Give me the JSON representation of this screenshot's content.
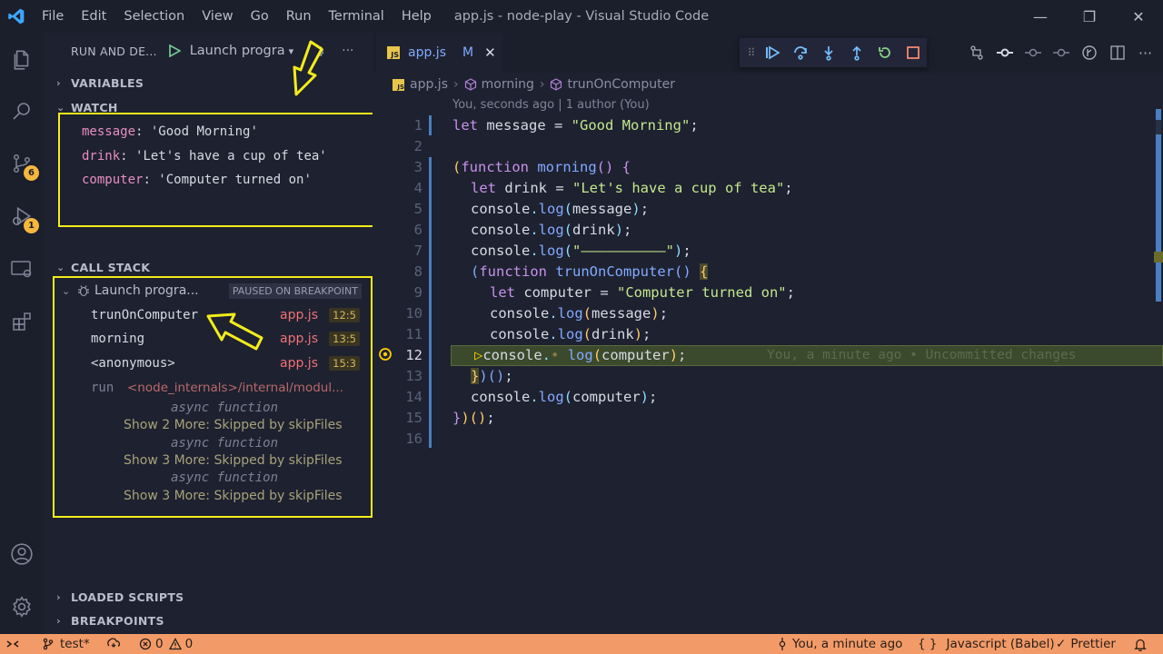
{
  "titlebar": {
    "menu": [
      "File",
      "Edit",
      "Selection",
      "View",
      "Go",
      "Run",
      "Terminal",
      "Help"
    ],
    "title": "app.js - node-play - Visual Studio Code"
  },
  "activity": {
    "source_control_badge": "6",
    "debug_badge": "1"
  },
  "sidebar": {
    "header_title": "RUN AND DE...",
    "launch_config": "Launch progra",
    "sections": {
      "variables": "VARIABLES",
      "watch": "WATCH",
      "call_stack": "CALL STACK",
      "loaded_scripts": "LOADED SCRIPTS",
      "breakpoints": "BREAKPOINTS"
    },
    "watch": [
      {
        "name": "message",
        "value": "'Good Morning'"
      },
      {
        "name": "drink",
        "value": "'Let's have a cup of tea'"
      },
      {
        "name": "computer",
        "value": "'Computer turned on'"
      }
    ],
    "call_stack": {
      "session": "Launch progra...",
      "status": "PAUSED ON BREAKPOINT",
      "frames": [
        {
          "fn": "trunOnComputer",
          "file": "app.js",
          "pos": "12:5"
        },
        {
          "fn": "morning",
          "file": "app.js",
          "pos": "13:5"
        },
        {
          "fn": "<anonymous>",
          "file": "app.js",
          "pos": "15:3"
        }
      ],
      "run_frame": {
        "fn": "run",
        "file": "<node_internals>/internal/modul..."
      },
      "async_label": "async function",
      "more": [
        "Show 2 More: Skipped by skipFiles",
        "Show 3 More: Skipped by skipFiles",
        "Show 3 More: Skipped by skipFiles"
      ]
    }
  },
  "editor": {
    "tab": {
      "icon": "JS",
      "name": "app.js",
      "modified": "M"
    },
    "breadcrumb": [
      "app.js",
      "morning",
      "trunOnComputer"
    ],
    "blame": "You, seconds ago | 1 author (You)",
    "inline_blame": "You, a minute ago • Uncommitted changes",
    "current_line": "12",
    "line_numbers": [
      "1",
      "2",
      "3",
      "4",
      "5",
      "6",
      "7",
      "8",
      "9",
      "10",
      "11",
      "12",
      "13",
      "14",
      "15",
      "16"
    ],
    "code": {
      "l1_kw": "let",
      "l1_var": " message = ",
      "l1_str": "\"Good Morning\"",
      "l1_end": ";",
      "l3_kw": "function",
      "l3_name": " morning",
      "l4_kw": "let",
      "l4_var": " drink = ",
      "l4_str": "\"Let's have a cup of tea\"",
      "console": "console",
      "log": "log",
      "l5_arg": "message",
      "l6_arg": "drink",
      "l7_str": "\"——————————\"",
      "l8_kw": "function",
      "l8_name": " trunOnComputer",
      "l9_kw": "let",
      "l9_var": " computer = ",
      "l9_str": "\"Computer turned on\"",
      "l10_arg": "message",
      "l11_arg": "drink",
      "l12_arg": "computer",
      "l14_arg": "computer"
    }
  },
  "statusbar": {
    "branch": "test*",
    "errors": "0",
    "warnings": "0",
    "blame": "You, a minute ago",
    "language": "Javascript (Babel)",
    "formatter": "Prettier"
  },
  "colors": {
    "accent": "#f29b68",
    "highlight": "#f3ec1a",
    "badge": "#f5b83d"
  }
}
